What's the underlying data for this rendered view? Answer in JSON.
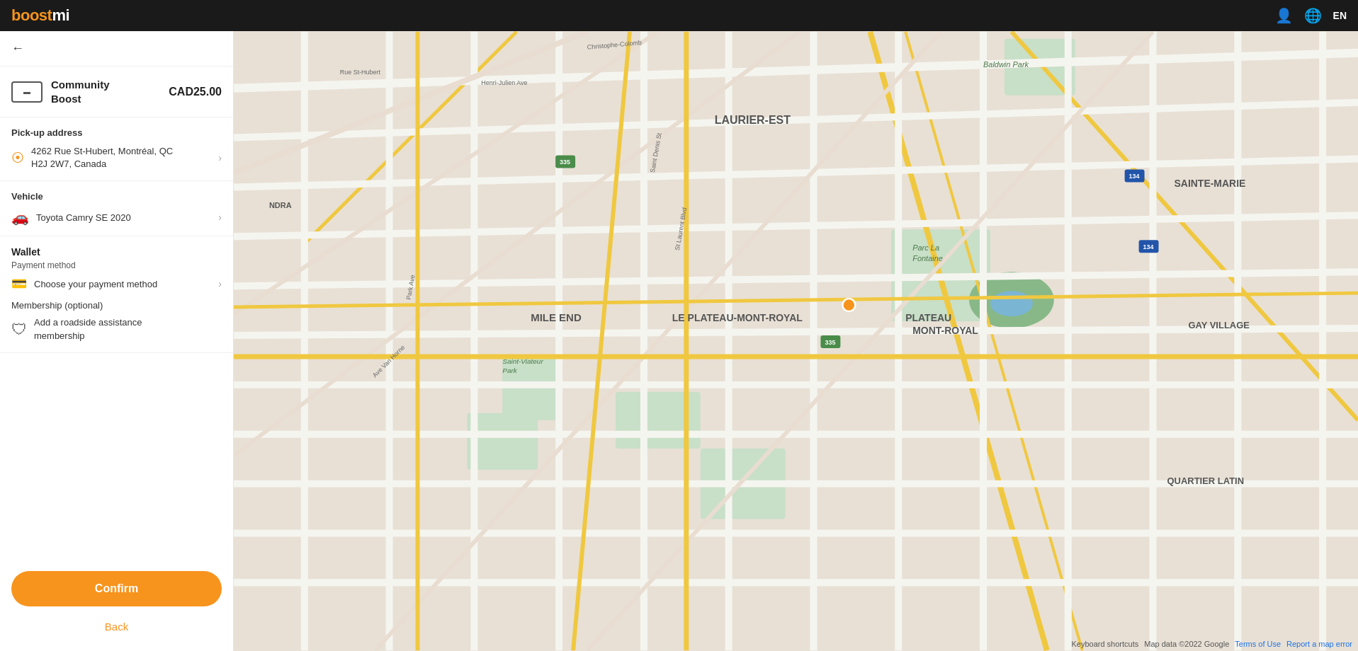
{
  "topbar": {
    "logo_boost": "boost",
    "logo_mi": "mi",
    "lang_label": "EN"
  },
  "panel": {
    "back_label": "‹",
    "service": {
      "name_line1": "Community",
      "name_line2": "Boost",
      "price": "CAD25.00",
      "icon_label": "▬"
    },
    "pickup": {
      "section_label": "Pick-up address",
      "address_line1": "4262 Rue St-Hubert, Montréal, QC",
      "address_line2": "H2J 2W7, Canada"
    },
    "vehicle": {
      "section_label": "Vehicle",
      "vehicle_name": "Toyota Camry SE 2020"
    },
    "wallet": {
      "wallet_label": "Wallet",
      "payment_method_label": "Payment method",
      "payment_placeholder": "Choose your payment method",
      "membership_label": "Membership (optional)",
      "membership_text_line1": "Add a roadside assistance",
      "membership_text_line2": "membership"
    },
    "confirm_label": "Confirm",
    "back_btn_label": "Back"
  },
  "map": {
    "copyright": "Map data ©2022 Google",
    "terms_label": "Terms of Use",
    "report_label": "Report a map error",
    "keyboard_label": "Keyboard shortcuts"
  }
}
